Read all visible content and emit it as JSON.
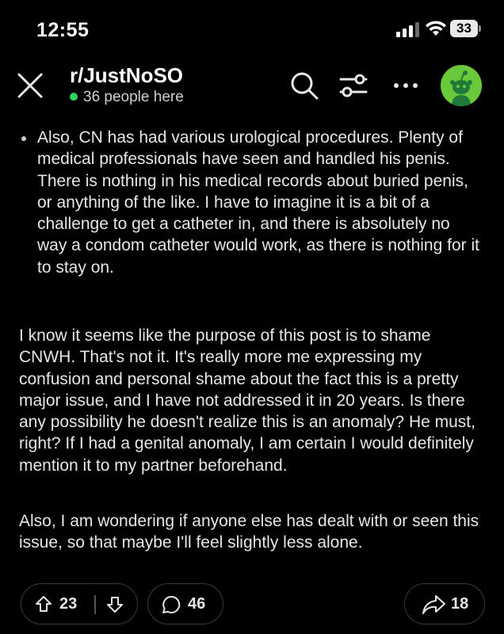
{
  "status_bar": {
    "time": "12:55",
    "battery": "33"
  },
  "header": {
    "subreddit": "r/JustNoSO",
    "online": "36 people here",
    "online_color": "#2bd45a",
    "icons": [
      "close-icon",
      "search-icon",
      "filter-icon",
      "more-icon",
      "avatar"
    ]
  },
  "post": {
    "bullet": "Also, CN has had various urological procedures. Plenty of medical professionals have seen and handled his penis. There is nothing in his medical records about buried penis, or anything of the like. I have to imagine it is a bit of a challenge to get a catheter in, and there is absolutely no way a condom catheter would work, as there is nothing for it to stay on.",
    "paragraphs": [
      "I know it seems like the purpose of this post is to shame CNWH. That's not it. It's really more me expressing my confusion and personal shame about the fact this is a pretty major issue, and I have not addressed it in 20 years. Is there any possibility he doesn't realize this is an anomaly? He must, right? If I had a genital anomaly, I am certain I would definitely mention it to my partner beforehand.",
      "Also, I am wondering if anyone else has dealt with or seen this issue, so that maybe I'll feel slightly less alone."
    ]
  },
  "actions": {
    "upvotes": "23",
    "comments": "46",
    "shares": "18"
  }
}
